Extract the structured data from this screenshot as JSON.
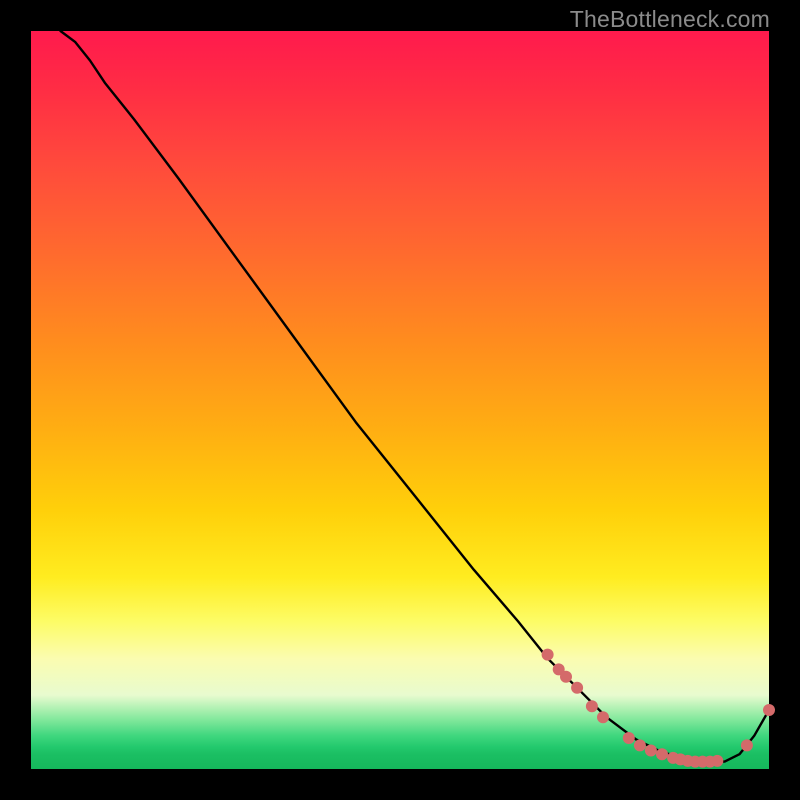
{
  "watermark": "TheBottleneck.com",
  "gradient_stops": [
    {
      "pos": 0.0,
      "color": "#ff1a4d"
    },
    {
      "pos": 0.3,
      "color": "#ff6a2e"
    },
    {
      "pos": 0.65,
      "color": "#ffd00a"
    },
    {
      "pos": 0.85,
      "color": "#fbfcb0"
    },
    {
      "pos": 0.95,
      "color": "#3fd77e"
    },
    {
      "pos": 1.0,
      "color": "#15b85c"
    }
  ],
  "chart_data": {
    "type": "line",
    "title": "",
    "xlabel": "",
    "ylabel": "",
    "xlim": [
      0,
      100
    ],
    "ylim": [
      0,
      100
    ],
    "series": [
      {
        "name": "bottleneck-curve",
        "color": "#000000",
        "x": [
          4,
          6,
          8,
          10,
          14,
          20,
          28,
          36,
          44,
          52,
          60,
          66,
          70,
          74,
          78,
          82,
          85,
          88,
          91,
          94,
          96,
          98,
          100
        ],
        "y": [
          100,
          98.5,
          96,
          93,
          88,
          80,
          69,
          58,
          47,
          37,
          27,
          20,
          15,
          11,
          7,
          4,
          2.5,
          1.5,
          1.0,
          1.0,
          2.0,
          4.5,
          8
        ]
      }
    ],
    "markers": [
      {
        "name": "highlighted-points",
        "color": "#d46a6a",
        "radius": 6,
        "points": [
          {
            "x": 70,
            "y": 15.5
          },
          {
            "x": 71.5,
            "y": 13.5
          },
          {
            "x": 72.5,
            "y": 12.5
          },
          {
            "x": 74,
            "y": 11
          },
          {
            "x": 76,
            "y": 8.5
          },
          {
            "x": 77.5,
            "y": 7
          },
          {
            "x": 81,
            "y": 4.2
          },
          {
            "x": 82.5,
            "y": 3.2
          },
          {
            "x": 84,
            "y": 2.5
          },
          {
            "x": 85.5,
            "y": 2.0
          },
          {
            "x": 87,
            "y": 1.5
          },
          {
            "x": 88,
            "y": 1.3
          },
          {
            "x": 89,
            "y": 1.1
          },
          {
            "x": 90,
            "y": 1.0
          },
          {
            "x": 91,
            "y": 1.0
          },
          {
            "x": 92,
            "y": 1.0
          },
          {
            "x": 93,
            "y": 1.1
          },
          {
            "x": 97,
            "y": 3.2
          },
          {
            "x": 100,
            "y": 8
          }
        ]
      }
    ]
  }
}
